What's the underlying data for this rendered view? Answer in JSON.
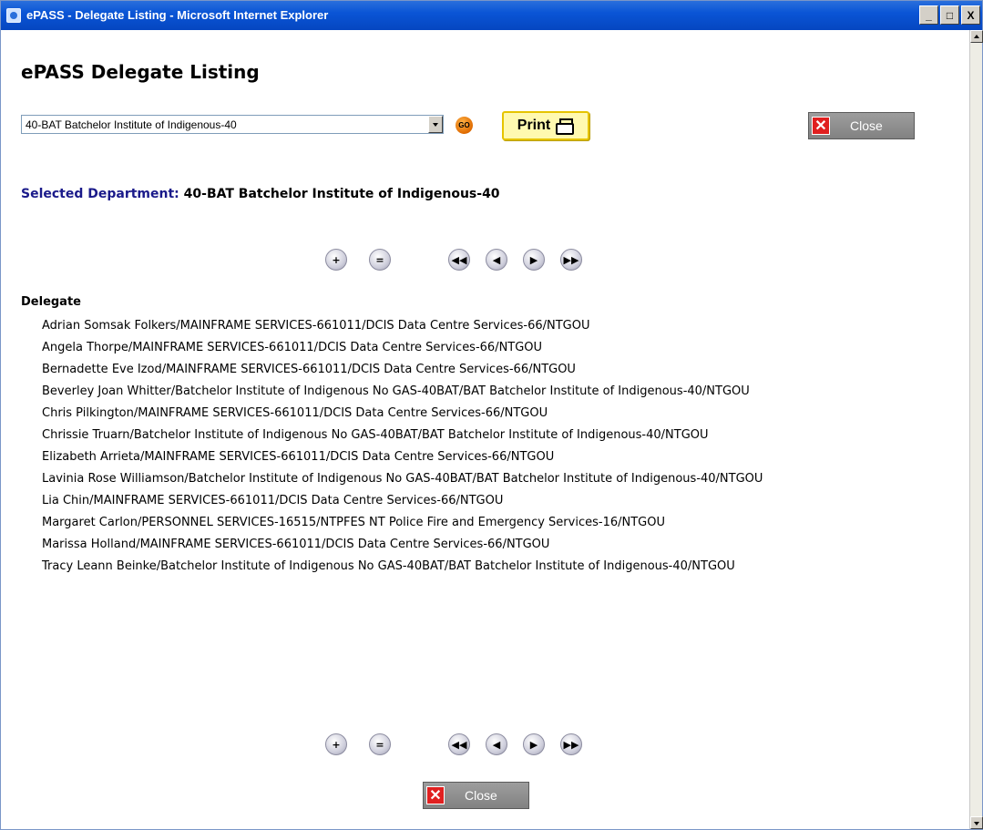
{
  "window": {
    "title": "ePASS - Delegate Listing - Microsoft Internet Explorer",
    "buttons": [
      "_",
      "□",
      "X"
    ]
  },
  "page": {
    "title": "ePASS Delegate Listing"
  },
  "department_select": {
    "selected": "40-BAT Batchelor Institute of Indigenous-40"
  },
  "buttons": {
    "go": "GO",
    "print": "Print",
    "close": "Close"
  },
  "selected_department": {
    "label": "Selected Department:",
    "value": "40-BAT Batchelor Institute of Indigenous-40"
  },
  "pager": {
    "expand_icon": "plus-icon",
    "collapse_icon": "minus-icon",
    "first_icon": "first-page-icon",
    "prev_icon": "prev-page-icon",
    "next_icon": "next-page-icon",
    "last_icon": "last-page-icon"
  },
  "delegates": {
    "header": "Delegate",
    "items": [
      "Adrian Somsak Folkers/MAINFRAME SERVICES-661011/DCIS Data Centre Services-66/NTGOU",
      "Angela Thorpe/MAINFRAME SERVICES-661011/DCIS Data Centre Services-66/NTGOU",
      "Bernadette Eve Izod/MAINFRAME SERVICES-661011/DCIS Data Centre Services-66/NTGOU",
      "Beverley Joan Whitter/Batchelor Institute of Indigenous No GAS-40BAT/BAT Batchelor Institute of Indigenous-40/NTGOU",
      "Chris Pilkington/MAINFRAME SERVICES-661011/DCIS Data Centre Services-66/NTGOU",
      "Chrissie Truarn/Batchelor Institute of Indigenous No GAS-40BAT/BAT Batchelor Institute of Indigenous-40/NTGOU",
      "Elizabeth Arrieta/MAINFRAME SERVICES-661011/DCIS Data Centre Services-66/NTGOU",
      "Lavinia Rose Williamson/Batchelor Institute of Indigenous No GAS-40BAT/BAT Batchelor Institute of Indigenous-40/NTGOU",
      "Lia Chin/MAINFRAME SERVICES-661011/DCIS Data Centre Services-66/NTGOU",
      "Margaret Carlon/PERSONNEL SERVICES-16515/NTPFES NT Police Fire and Emergency Services-16/NTGOU",
      "Marissa Holland/MAINFRAME SERVICES-661011/DCIS Data Centre Services-66/NTGOU",
      "Tracy Leann Beinke/Batchelor Institute of Indigenous No GAS-40BAT/BAT Batchelor Institute of Indigenous-40/NTGOU"
    ]
  },
  "colors": {
    "titlebar": "#0a55d6",
    "close_button": "#8c8c8c",
    "close_x": "#e02020",
    "print_button": "#fff9b0",
    "selected_label": "#1a1a8a",
    "go_button": "#e06b00"
  }
}
